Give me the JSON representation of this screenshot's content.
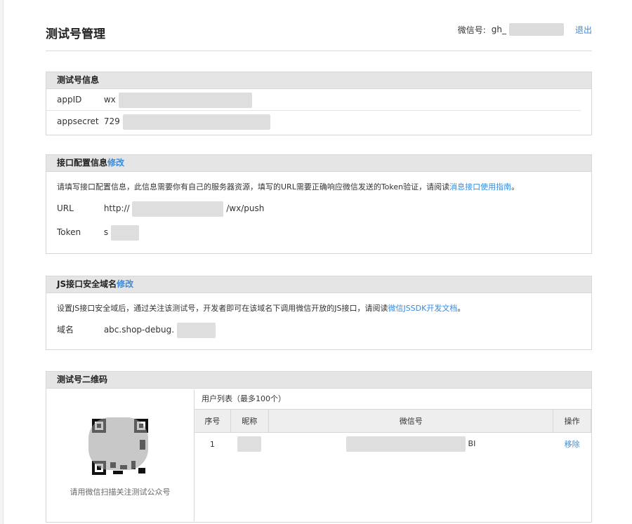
{
  "page": {
    "title": "测试号管理",
    "account_label": "微信号:",
    "account_prefix": "gh_",
    "logout_label": "退出"
  },
  "test_info": {
    "heading": "测试号信息",
    "appid_label": "appID",
    "appid_value": "wx",
    "appsecret_label": "appsecret",
    "appsecret_value": "729"
  },
  "api_config": {
    "heading": "接口配置信息",
    "edit_label": "修改",
    "note_text": "请填写接口配置信息，此信息需要你有自己的服务器资源，填写的URL需要正确响应微信发送的Token验证，请阅读",
    "note_link": "消息接口使用指南",
    "note_end": "。",
    "url_label": "URL",
    "url_prefix": "http://",
    "url_suffix": "/wx/push",
    "token_label": "Token",
    "token_value": "s"
  },
  "js_domain": {
    "heading": "JS接口安全域名",
    "edit_label": "修改",
    "note_text": "设置JS接口安全域后，通过关注该测试号，开发者即可在该域名下调用微信开放的JS接口，请阅读",
    "note_link": "微信JSSDK开发文档",
    "note_end": "。",
    "domain_label": "域名",
    "domain_value": "abc.shop-debug."
  },
  "qrcode": {
    "heading": "测试号二维码",
    "caption": "请用微信扫描关注测试公众号",
    "users_caption": "用户列表（最多100个）",
    "columns": [
      "序号",
      "昵称",
      "微信号",
      "操作"
    ],
    "rows": [
      {
        "index": "1",
        "nickname": "",
        "wechat_id_tail": "BI",
        "action": "移除"
      }
    ]
  }
}
